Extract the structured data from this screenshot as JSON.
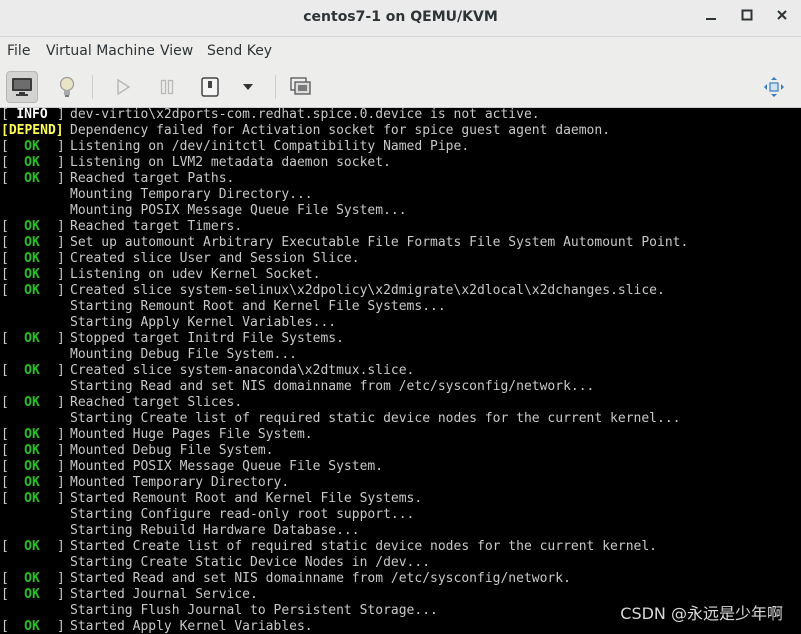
{
  "window": {
    "title": "centos7-1 on QEMU/KVM",
    "minimize_icon": "minimize-icon",
    "maximize_icon": "maximize-icon",
    "close_icon": "close-icon"
  },
  "menubar": {
    "items": [
      "File",
      "Virtual Machine",
      "View",
      "Send Key"
    ]
  },
  "toolbar": {
    "buttons": [
      "console-icon",
      "details-bulb-icon",
      "run-icon",
      "pause-icon",
      "shutdown-icon",
      "dropdown-chevron-icon",
      "snapshot-icon",
      "fullscreen-icon"
    ]
  },
  "colors": {
    "ok": "#22c322",
    "info": "#ffffff",
    "depend": "#ffff55",
    "text": "#c8c8c8",
    "console_bg": "#000000"
  },
  "console": {
    "lines": [
      {
        "status": "INFO",
        "text": "dev-virtio\\x2dports-com.redhat.spice.0.device is not active."
      },
      {
        "status": "DEPEND",
        "text": "Dependency failed for Activation socket for spice guest agent daemon."
      },
      {
        "status": "OK",
        "text": "Listening on /dev/initctl Compatibility Named Pipe."
      },
      {
        "status": "OK",
        "text": "Listening on LVM2 metadata daemon socket."
      },
      {
        "status": "OK",
        "text": "Reached target Paths."
      },
      {
        "status": "",
        "text": "Mounting Temporary Directory..."
      },
      {
        "status": "",
        "text": "Mounting POSIX Message Queue File System..."
      },
      {
        "status": "OK",
        "text": "Reached target Timers."
      },
      {
        "status": "OK",
        "text": "Set up automount Arbitrary Executable File Formats File System Automount Point."
      },
      {
        "status": "OK",
        "text": "Created slice User and Session Slice."
      },
      {
        "status": "OK",
        "text": "Listening on udev Kernel Socket."
      },
      {
        "status": "OK",
        "text": "Created slice system-selinux\\x2dpolicy\\x2dmigrate\\x2dlocal\\x2dchanges.slice."
      },
      {
        "status": "",
        "text": "Starting Remount Root and Kernel File Systems..."
      },
      {
        "status": "",
        "text": "Starting Apply Kernel Variables..."
      },
      {
        "status": "OK",
        "text": "Stopped target Initrd File Systems."
      },
      {
        "status": "",
        "text": "Mounting Debug File System..."
      },
      {
        "status": "OK",
        "text": "Created slice system-anaconda\\x2dtmux.slice."
      },
      {
        "status": "",
        "text": "Starting Read and set NIS domainname from /etc/sysconfig/network..."
      },
      {
        "status": "OK",
        "text": "Reached target Slices."
      },
      {
        "status": "",
        "text": "Starting Create list of required static device nodes for the current kernel..."
      },
      {
        "status": "OK",
        "text": "Mounted Huge Pages File System."
      },
      {
        "status": "OK",
        "text": "Mounted Debug File System."
      },
      {
        "status": "OK",
        "text": "Mounted POSIX Message Queue File System."
      },
      {
        "status": "OK",
        "text": "Mounted Temporary Directory."
      },
      {
        "status": "OK",
        "text": "Started Remount Root and Kernel File Systems."
      },
      {
        "status": "",
        "text": "Starting Configure read-only root support..."
      },
      {
        "status": "",
        "text": "Starting Rebuild Hardware Database..."
      },
      {
        "status": "OK",
        "text": "Started Create list of required static device nodes for the current kernel."
      },
      {
        "status": "",
        "text": "Starting Create Static Device Nodes in /dev..."
      },
      {
        "status": "OK",
        "text": "Started Read and set NIS domainname from /etc/sysconfig/network."
      },
      {
        "status": "OK",
        "text": "Started Journal Service."
      },
      {
        "status": "",
        "text": "Starting Flush Journal to Persistent Storage..."
      },
      {
        "status": "OK",
        "text": "Started Apply Kernel Variables."
      }
    ]
  },
  "watermark": "CSDN @永远是少年啊"
}
